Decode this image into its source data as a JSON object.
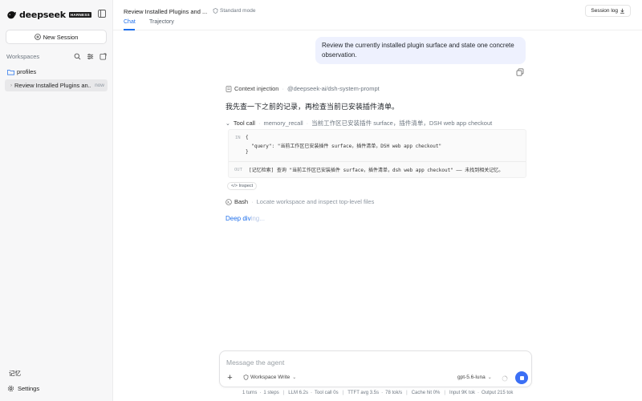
{
  "app": {
    "brand_name": "deepseek",
    "brand_badge": "HARNESS"
  },
  "sidebar": {
    "new_session_label": "New Session",
    "workspaces_label": "Workspaces",
    "folder_label": "profiles",
    "session": {
      "title": "Review Installed Plugins an...",
      "time": "now"
    },
    "memory_label": "记忆",
    "settings_label": "Settings"
  },
  "header": {
    "conversation_title": "Review Installed Plugins and ...",
    "mode_label": "Standard mode",
    "tabs": [
      {
        "label": "Chat",
        "active": true
      },
      {
        "label": "Trajectory",
        "active": false
      }
    ],
    "session_log_label": "Session log"
  },
  "chat": {
    "user_message": "Review the currently installed plugin surface and state one concrete observation.",
    "context": {
      "label": "Context injection",
      "source": "@deepseek-ai/dsh-system-prompt"
    },
    "assistant_text": "我先查一下之前的记录，再检查当前已安装插件清单。",
    "tool_call": {
      "label": "Tool call",
      "name": "memory_recall",
      "summary": "当前工作区已安装插件 surface，插件清单，DSH web app checkout",
      "in_tag": "IN",
      "in_lines": [
        "{",
        "  \"query\": \"当前工作区已安装插件 surface，插件清单，DSH web app checkout\"",
        "}"
      ],
      "out_tag": "OUT",
      "out_text": "[记忆检索] 查询 \"当前工作区已安装插件 surface，插件清单，dsh web app checkout\" —— 未找到相关记忆。",
      "inspect_label": "</> Inspect"
    },
    "bash": {
      "label": "Bash",
      "description": "Locate workspace and inspect top-level files"
    },
    "status_text": {
      "main": "Deep div",
      "fade": "ing..."
    }
  },
  "composer": {
    "placeholder": "Message the agent",
    "workspace_mode": "Workspace Write",
    "model": "gpt-5.6-luna"
  },
  "statusbar": {
    "turns": "1 turns",
    "steps": "1 steps",
    "llm": "LLM 6.2s",
    "tool": "Tool call 0s",
    "ttft": "TTFT avg 3.5s",
    "toks": "78 tok/s",
    "cache": "Cache hit 0%",
    "input": "Input 9K tok",
    "output": "Output 215 tok"
  },
  "colors": {
    "accent": "#1f6feb",
    "send_button": "#3b6ff5",
    "user_bubble": "#eef1fe",
    "sidebar_bg": "#f7f7f8"
  },
  "icons": [
    "whale-logo-icon",
    "sidebar-toggle-icon",
    "plus-circle-icon",
    "search-icon",
    "filter-icon",
    "refresh-icon",
    "folder-icon",
    "chevron-right-icon",
    "gear-icon",
    "shield-icon",
    "download-icon",
    "copy-icon",
    "document-icon",
    "chevron-down-icon",
    "terminal-icon",
    "plus-icon",
    "spinner-icon",
    "stop-icon"
  ]
}
